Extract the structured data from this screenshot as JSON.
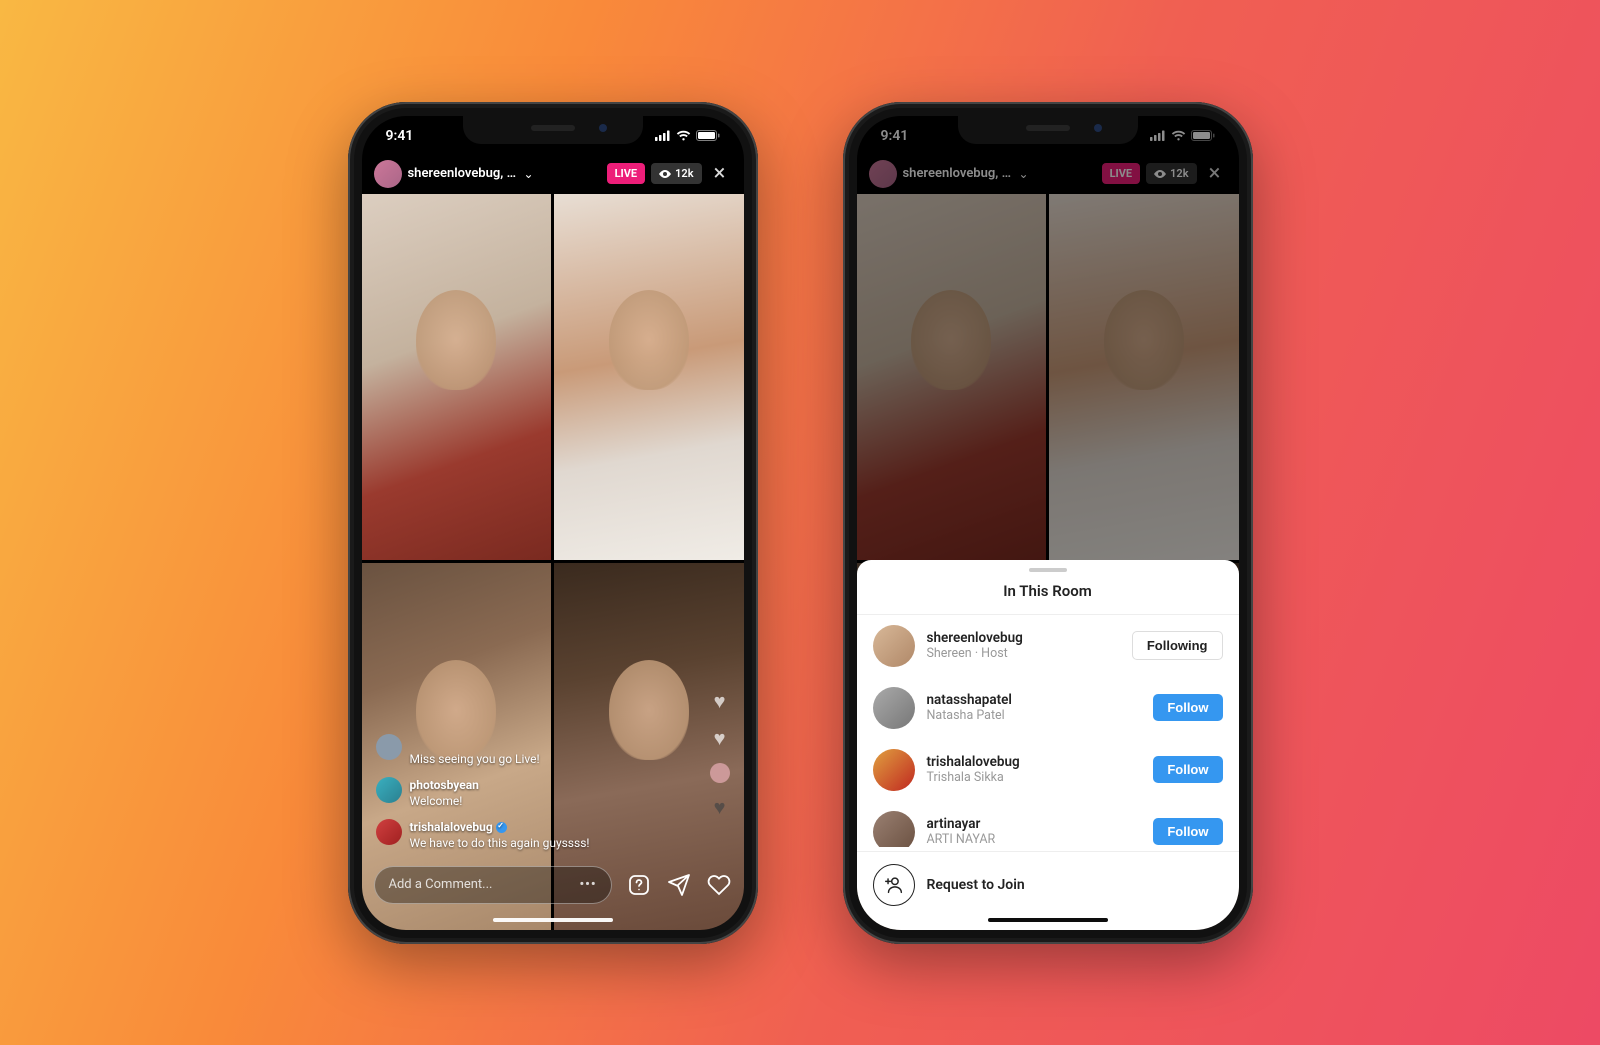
{
  "status": {
    "time": "9:41"
  },
  "header": {
    "username_truncated": "shereenlovebug, n...",
    "live_label": "LIVE",
    "viewer_count": "12k"
  },
  "comments": [
    {
      "user": "",
      "text": "Miss seeing you go Live!",
      "verified": false
    },
    {
      "user": "photosbyean",
      "text": "Welcome!",
      "verified": false
    },
    {
      "user": "trishalalovebug",
      "text": "We have to do this again guyssss!",
      "verified": true
    }
  ],
  "input": {
    "placeholder": "Add a Comment..."
  },
  "sheet": {
    "title": "In This Room",
    "participants": [
      {
        "username": "shereenlovebug",
        "subtitle": "Shereen · Host",
        "button": "Following",
        "state": "following"
      },
      {
        "username": "natasshapatel",
        "subtitle": "Natasha Patel",
        "button": "Follow",
        "state": "follow"
      },
      {
        "username": "trishalalovebug",
        "subtitle": "Trishala Sikka",
        "button": "Follow",
        "state": "follow"
      },
      {
        "username": "artinayar",
        "subtitle": "ARTI NAYAR",
        "button": "Follow",
        "state": "follow"
      }
    ],
    "request_label": "Request to Join"
  }
}
